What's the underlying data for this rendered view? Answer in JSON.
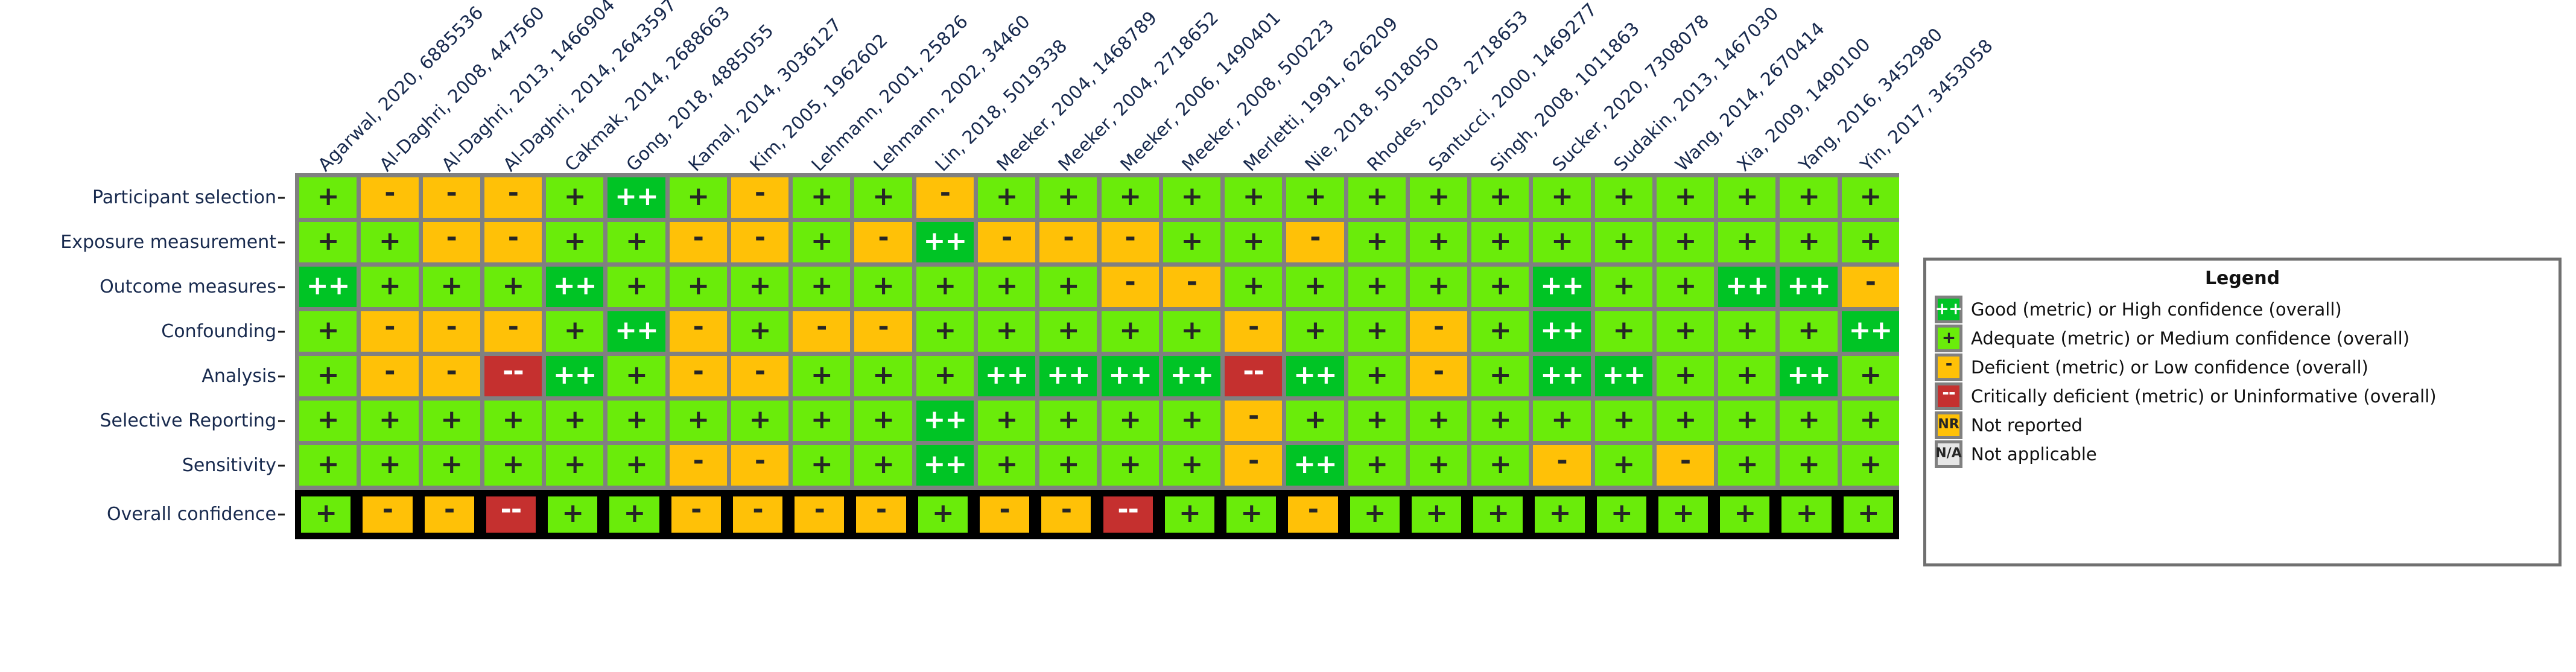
{
  "figure": {
    "type": "risk-of-bias-heatmap",
    "colors": {
      "good": "#00c425",
      "adequate": "#6aec0a",
      "deficient": "#ffc107",
      "critically_deficient": "#c5302f",
      "not_reported": "#ffc107",
      "not_applicable": "#e6e6e6",
      "grid_line": "#808080",
      "overall_band": "#000000",
      "label_text": "#182a4e"
    },
    "glyphs": {
      "good": "++",
      "adequate": "+",
      "deficient": "-",
      "critically_deficient": "--",
      "not_reported": "NR",
      "not_applicable": "N/A"
    }
  },
  "legend": {
    "title": "Legend",
    "entries": [
      {
        "key": "good",
        "symbol": "++",
        "label": "Good (metric) or High confidence (overall)"
      },
      {
        "key": "adequate",
        "symbol": "+",
        "label": "Adequate (metric) or Medium confidence (overall)"
      },
      {
        "key": "deficient",
        "symbol": "-",
        "label": "Deficient (metric) or Low confidence (overall)"
      },
      {
        "key": "critically_deficient",
        "symbol": "--",
        "label": "Critically deficient (metric) or Uninformative (overall)"
      },
      {
        "key": "not_reported",
        "symbol": "NR",
        "label": "Not reported"
      },
      {
        "key": "not_applicable",
        "symbol": "N/A",
        "label": "Not applicable"
      }
    ]
  },
  "chart_data": {
    "type": "heatmap",
    "title": "",
    "xlabel": "",
    "ylabel": "",
    "legend_position": "right",
    "grid": true,
    "categories": [
      "Agarwal, 2020, 6885536",
      "Al-Daghri, 2008, 447560",
      "Al-Daghri, 2013, 1466904",
      "Al-Daghri, 2014, 2643597",
      "Cakmak, 2014, 2688663",
      "Gong, 2018, 4885055",
      "Kamal, 2014, 3036127",
      "Kim, 2005, 1962602",
      "Lehmann, 2001, 25826",
      "Lehmann, 2002, 34460",
      "Lin, 2018, 5019338",
      "Meeker, 2004, 1468789",
      "Meeker, 2004, 2718652",
      "Meeker, 2006, 1490401",
      "Meeker, 2008, 500223",
      "Merletti, 1991, 626209",
      "Nie, 2018, 5018050",
      "Rhodes, 2003, 2718653",
      "Santucci, 2000, 1469277",
      "Singh, 2008, 1011863",
      "Sucker, 2020, 7308078",
      "Sudakin, 2013, 1467030",
      "Wang, 2014, 2670414",
      "Xia, 2009, 1490100",
      "Yang, 2016, 3452980",
      "Yin, 2017, 3453058"
    ],
    "rows": [
      "Participant selection",
      "Exposure measurement",
      "Outcome measures",
      "Confounding",
      "Analysis",
      "Selective Reporting",
      "Sensitivity",
      "Overall confidence"
    ],
    "values": [
      [
        "+",
        "-",
        "-",
        "-",
        "+",
        "++",
        "+",
        "-",
        "+",
        "+",
        "-",
        "+",
        "+",
        "+",
        "+",
        "+",
        "+",
        "+",
        "+",
        "+",
        "+",
        "+",
        "+",
        "+",
        "+",
        "+"
      ],
      [
        "+",
        "+",
        "-",
        "-",
        "+",
        "+",
        "-",
        "-",
        "+",
        "-",
        "++",
        "-",
        "-",
        "-",
        "+",
        "+",
        "-",
        "+",
        "+",
        "+",
        "+",
        "+",
        "+",
        "+",
        "+",
        "+"
      ],
      [
        "++",
        "+",
        "+",
        "+",
        "++",
        "+",
        "+",
        "+",
        "+",
        "+",
        "+",
        "+",
        "+",
        "-",
        "-",
        "+",
        "+",
        "+",
        "+",
        "+",
        "++",
        "+",
        "+",
        "++",
        "++",
        "-"
      ],
      [
        "+",
        "-",
        "-",
        "-",
        "+",
        "++",
        "-",
        "+",
        "-",
        "-",
        "+",
        "+",
        "+",
        "+",
        "+",
        "-",
        "+",
        "+",
        "-",
        "+",
        "++",
        "+",
        "+",
        "+",
        "+",
        "++"
      ],
      [
        "+",
        "-",
        "-",
        "--",
        "++",
        "+",
        "-",
        "-",
        "+",
        "+",
        "+",
        "++",
        "++",
        "++",
        "++",
        "--",
        "++",
        "+",
        "-",
        "+",
        "++",
        "++",
        "+",
        "+",
        "++",
        "+"
      ],
      [
        "+",
        "+",
        "+",
        "+",
        "+",
        "+",
        "+",
        "+",
        "+",
        "+",
        "++",
        "+",
        "+",
        "+",
        "+",
        "-",
        "+",
        "+",
        "+",
        "+",
        "+",
        "+",
        "+",
        "+",
        "+",
        "+"
      ],
      [
        "+",
        "+",
        "+",
        "+",
        "+",
        "+",
        "-",
        "-",
        "+",
        "+",
        "++",
        "+",
        "+",
        "+",
        "+",
        "-",
        "++",
        "+",
        "+",
        "+",
        "-",
        "+",
        "-",
        "+",
        "+",
        "+"
      ],
      [
        "+",
        "-",
        "-",
        "--",
        "+",
        "+",
        "-",
        "-",
        "-",
        "-",
        "+",
        "-",
        "-",
        "--",
        "+",
        "+",
        "-",
        "+",
        "+",
        "+",
        "+",
        "+",
        "+",
        "+",
        "+",
        "+"
      ]
    ]
  }
}
